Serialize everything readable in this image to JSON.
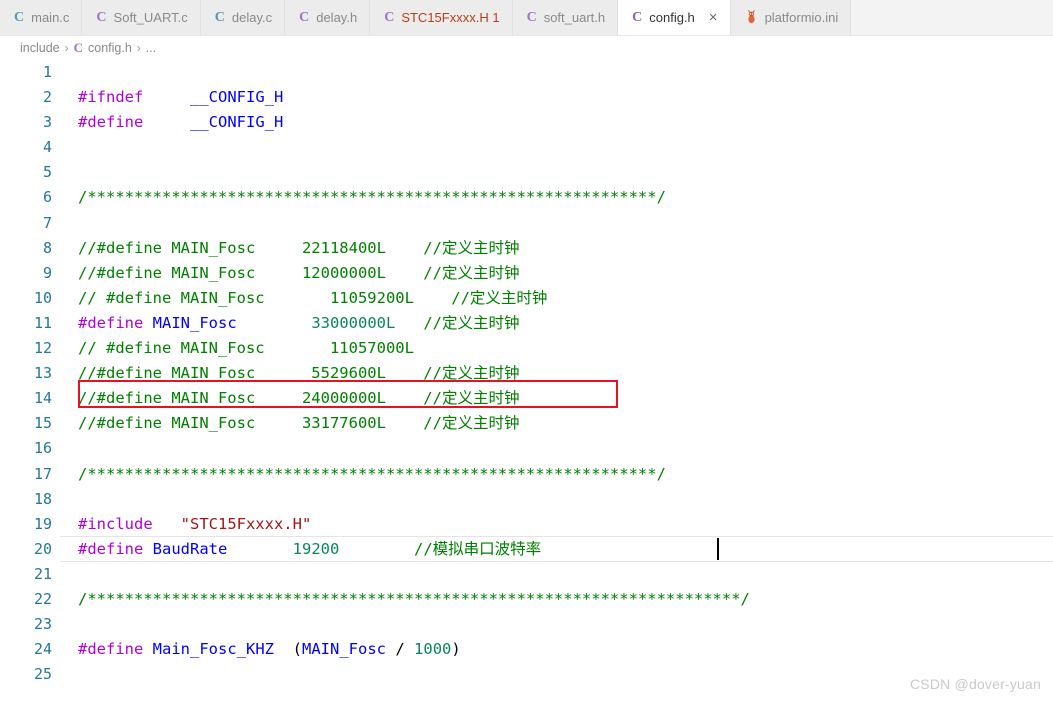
{
  "tabs": [
    {
      "label": "main.c",
      "icon": "c-file-icon",
      "icon_glyph": "C",
      "icon_class": "c-blue",
      "active": false,
      "error": false,
      "closable": false
    },
    {
      "label": "Soft_UART.c",
      "icon": "c-file-icon",
      "icon_glyph": "C",
      "icon_class": "c-purple",
      "active": false,
      "error": false,
      "closable": false
    },
    {
      "label": "delay.c",
      "icon": "c-file-icon",
      "icon_glyph": "C",
      "icon_class": "c-blue",
      "active": false,
      "error": false,
      "closable": false
    },
    {
      "label": "delay.h",
      "icon": "c-file-icon",
      "icon_glyph": "C",
      "icon_class": "c-purple",
      "active": false,
      "error": false,
      "closable": false
    },
    {
      "label": "STC15Fxxxx.H 1",
      "icon": "c-file-icon",
      "icon_glyph": "C",
      "icon_class": "c-purple",
      "active": false,
      "error": true,
      "closable": false
    },
    {
      "label": "soft_uart.h",
      "icon": "c-file-icon",
      "icon_glyph": "C",
      "icon_class": "c-purple",
      "active": false,
      "error": false,
      "closable": false
    },
    {
      "label": "config.h",
      "icon": "c-file-icon",
      "icon_glyph": "C",
      "icon_class": "c-purple",
      "active": true,
      "error": false,
      "closable": true,
      "close_glyph": "×"
    },
    {
      "label": "platformio.ini",
      "icon": "platformio-ant-icon",
      "icon_glyph": "🐜",
      "icon_class": "ant",
      "active": false,
      "error": false,
      "closable": false
    }
  ],
  "breadcrumb": {
    "root": "include",
    "file": "config.h",
    "file_icon_glyph": "C",
    "tail": "...",
    "separator": "›"
  },
  "editor": {
    "first_line": 1,
    "lines": [
      {
        "n": 1,
        "tokens": []
      },
      {
        "n": 2,
        "tokens": [
          {
            "t": "#ifndef",
            "c": "t-pre"
          },
          {
            "t": "     ",
            "c": "t-punc"
          },
          {
            "t": "__CONFIG_H",
            "c": "t-id2"
          }
        ]
      },
      {
        "n": 3,
        "tokens": [
          {
            "t": "#define",
            "c": "t-pre"
          },
          {
            "t": "     ",
            "c": "t-punc"
          },
          {
            "t": "__CONFIG_H",
            "c": "t-id2"
          }
        ]
      },
      {
        "n": 4,
        "tokens": []
      },
      {
        "n": 5,
        "tokens": []
      },
      {
        "n": 6,
        "tokens": [
          {
            "t": "/*************************************************************/",
            "c": "t-cmt"
          }
        ]
      },
      {
        "n": 7,
        "tokens": []
      },
      {
        "n": 8,
        "tokens": [
          {
            "t": "//#define MAIN_Fosc     22118400L    //定义主时钟",
            "c": "t-cmt"
          }
        ]
      },
      {
        "n": 9,
        "tokens": [
          {
            "t": "//#define MAIN_Fosc     12000000L    //定义主时钟",
            "c": "t-cmt"
          }
        ]
      },
      {
        "n": 10,
        "tokens": [
          {
            "t": "// #define MAIN_Fosc       11059200L    //定义主时钟",
            "c": "t-cmt"
          }
        ]
      },
      {
        "n": 11,
        "tokens": [
          {
            "t": "#define",
            "c": "t-pre"
          },
          {
            "t": " ",
            "c": "t-punc"
          },
          {
            "t": "MAIN_Fosc",
            "c": "t-id2"
          },
          {
            "t": "        ",
            "c": "t-punc"
          },
          {
            "t": "33000000L",
            "c": "t-num"
          },
          {
            "t": "   ",
            "c": "t-punc"
          },
          {
            "t": "//定义主时钟",
            "c": "t-cmt"
          }
        ]
      },
      {
        "n": 12,
        "tokens": [
          {
            "t": "// #define MAIN_Fosc       11057000L",
            "c": "t-cmt"
          }
        ]
      },
      {
        "n": 13,
        "tokens": [
          {
            "t": "//#define MAIN_Fosc      5529600L    //定义主时钟",
            "c": "t-cmt"
          }
        ]
      },
      {
        "n": 14,
        "tokens": [
          {
            "t": "//#define MAIN_Fosc     24000000L    //定义主时钟",
            "c": "t-cmt"
          }
        ]
      },
      {
        "n": 15,
        "tokens": [
          {
            "t": "//#define MAIN_Fosc     33177600L    //定义主时钟",
            "c": "t-cmt"
          }
        ]
      },
      {
        "n": 16,
        "tokens": []
      },
      {
        "n": 17,
        "tokens": [
          {
            "t": "/*************************************************************/",
            "c": "t-cmt"
          }
        ]
      },
      {
        "n": 18,
        "tokens": []
      },
      {
        "n": 19,
        "tokens": [
          {
            "t": "#include",
            "c": "t-pre"
          },
          {
            "t": "   ",
            "c": "t-punc"
          },
          {
            "t": "\"STC15Fxxxx.H\"",
            "c": "t-str"
          }
        ]
      },
      {
        "n": 20,
        "tokens": [
          {
            "t": "#define",
            "c": "t-pre"
          },
          {
            "t": " ",
            "c": "t-punc"
          },
          {
            "t": "BaudRate",
            "c": "t-id2"
          },
          {
            "t": "       ",
            "c": "t-punc"
          },
          {
            "t": "19200",
            "c": "t-num"
          },
          {
            "t": "        ",
            "c": "t-punc"
          },
          {
            "t": "//模拟串口波特率",
            "c": "t-cmt"
          }
        ]
      },
      {
        "n": 21,
        "tokens": []
      },
      {
        "n": 22,
        "tokens": [
          {
            "t": "/**********************************************************************/",
            "c": "t-cmt"
          }
        ]
      },
      {
        "n": 23,
        "tokens": []
      },
      {
        "n": 24,
        "tokens": [
          {
            "t": "#define",
            "c": "t-pre"
          },
          {
            "t": " ",
            "c": "t-punc"
          },
          {
            "t": "Main_Fosc_KHZ",
            "c": "t-id2"
          },
          {
            "t": "  ",
            "c": "t-punc"
          },
          {
            "t": "(",
            "c": "t-punc"
          },
          {
            "t": "MAIN_Fosc",
            "c": "t-id2"
          },
          {
            "t": " ",
            "c": "t-punc"
          },
          {
            "t": "/",
            "c": "t-op"
          },
          {
            "t": " ",
            "c": "t-punc"
          },
          {
            "t": "1000",
            "c": "t-num"
          },
          {
            "t": ")",
            "c": "t-punc"
          }
        ]
      },
      {
        "n": 25,
        "tokens": []
      }
    ],
    "highlight_box": {
      "line": 11,
      "color": "#e81123"
    },
    "current_line": 17,
    "cursor_line": 17
  },
  "watermark": "CSDN @dover-yuan",
  "colors": {
    "preprocessor": "#af00db",
    "identifier": "#0000ff",
    "number": "#098658",
    "comment": "#008000",
    "string": "#a31515",
    "line_number": "#237893",
    "annotation_box": "#e81123",
    "tab_active_bg": "#ffffff",
    "tab_inactive_bg": "#ececec",
    "tabbar_bg": "#f3f3f3"
  }
}
